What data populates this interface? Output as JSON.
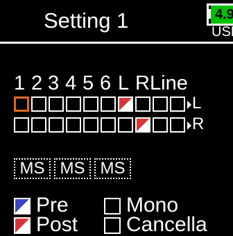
{
  "header": {
    "title": "Setting 1",
    "battery_text": "4.9",
    "power_source": "USB"
  },
  "channels": {
    "labels": [
      "1",
      "2",
      "3",
      "4",
      "5",
      "6",
      "L",
      "R",
      "Line"
    ]
  },
  "rows": [
    {
      "row_label": "L",
      "cells": [
        "empty",
        "empty",
        "empty",
        "empty",
        "empty",
        "empty",
        "post",
        "empty",
        "empty",
        "empty"
      ],
      "selected_index": 0
    },
    {
      "row_label": "R",
      "cells": [
        "empty",
        "empty",
        "empty",
        "empty",
        "empty",
        "empty",
        "empty",
        "post",
        "empty",
        "empty"
      ]
    }
  ],
  "ms_links": [
    "MS",
    "MS",
    "MS"
  ],
  "legend": {
    "pre_label": "Pre",
    "post_label": "Post",
    "mono_label": "Mono",
    "cancel_label": "Cancella"
  },
  "colors": {
    "pre": "#3b44c5",
    "post": "#d8343a",
    "cursor": "#e06a1c",
    "battery": "#00c000"
  }
}
